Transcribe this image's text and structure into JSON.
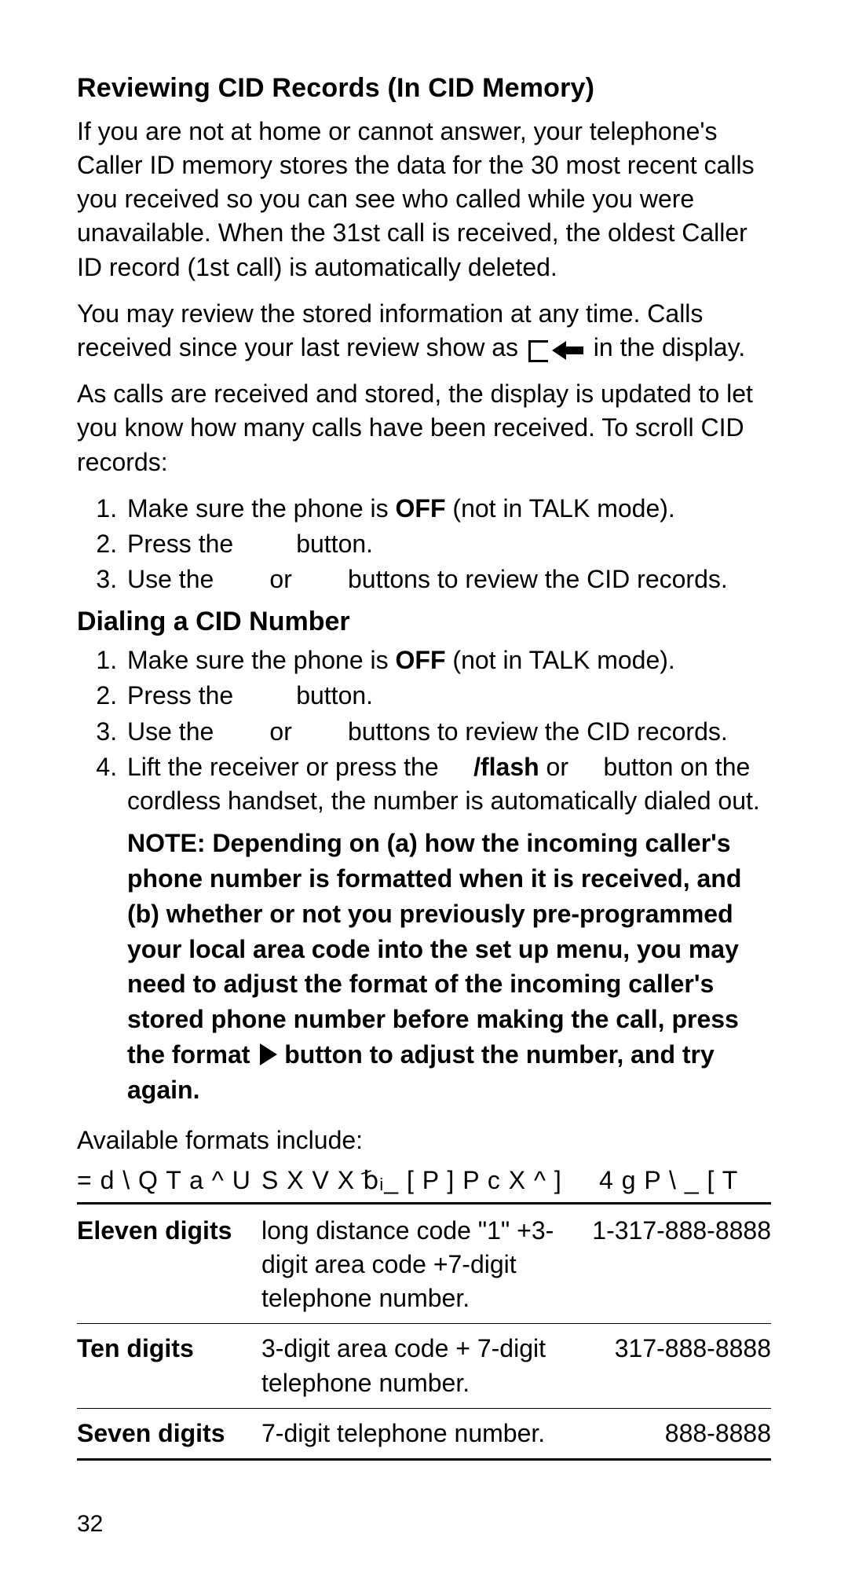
{
  "section1": {
    "title": "Reviewing CID Records (In CID Memory)",
    "p1": "If you are not at home or cannot answer, your telephone's Caller ID memory stores the data for the 30 most recent calls you received so you can see who called while you were unavailable. When the 31st call is received, the oldest Caller ID record (1st call) is automatically deleted.",
    "p2a": "You may review the stored information at any time. Calls received since your last review show as ",
    "p2b": " in the display.",
    "p3": "As calls are received and stored, the display is updated to let you know how many calls have been received. To scroll CID records:",
    "li1a": "Make sure the phone is ",
    "li1b": "OFF",
    "li1c": " (not in TALK mode).",
    "li2": "Press the         button.",
    "li3": "Use the        or        buttons to review the CID records."
  },
  "section2": {
    "title": "Dialing a CID Number",
    "li1a": "Make sure the phone is ",
    "li1b": "OFF",
    "li1c": " (not in TALK mode).",
    "li2": "Press the         button.",
    "li3": "Use the        or        buttons to review the CID records.",
    "li4a": "Lift the receiver or press the     ",
    "li4b": "/flash",
    "li4c": " or     button on the cordless handset, the number is automatically dialed out.",
    "note_a": "NOTE: Depending on (a) how the incoming caller's phone number is formatted when it is received, and (b) whether or not you previously pre-programmed your local area code into the set up menu, you may need to adjust the format of the incoming caller's stored phone number before making the call, press the format ",
    "note_b": " button to adjust the number, and try again."
  },
  "formats": {
    "intro": "Available formats include:",
    "header": {
      "c1": "= d \\ Q T a  ^ U",
      "c2": "S X V X ␢ᵢ_ [ P ] P c X ^ ]",
      "c3": "4 g P \\ _ [ T"
    },
    "rows": [
      {
        "name": "Eleven digits",
        "desc": "long distance code \"1\" +3-digit area code +7-digit telephone number.",
        "example": "1-317-888-8888"
      },
      {
        "name": "Ten digits",
        "desc": "3-digit area code + 7-digit telephone number.",
        "example": "317-888-8888"
      },
      {
        "name": "Seven digits",
        "desc": "7-digit telephone number.",
        "example": "888-8888"
      }
    ]
  },
  "page_number": "32"
}
